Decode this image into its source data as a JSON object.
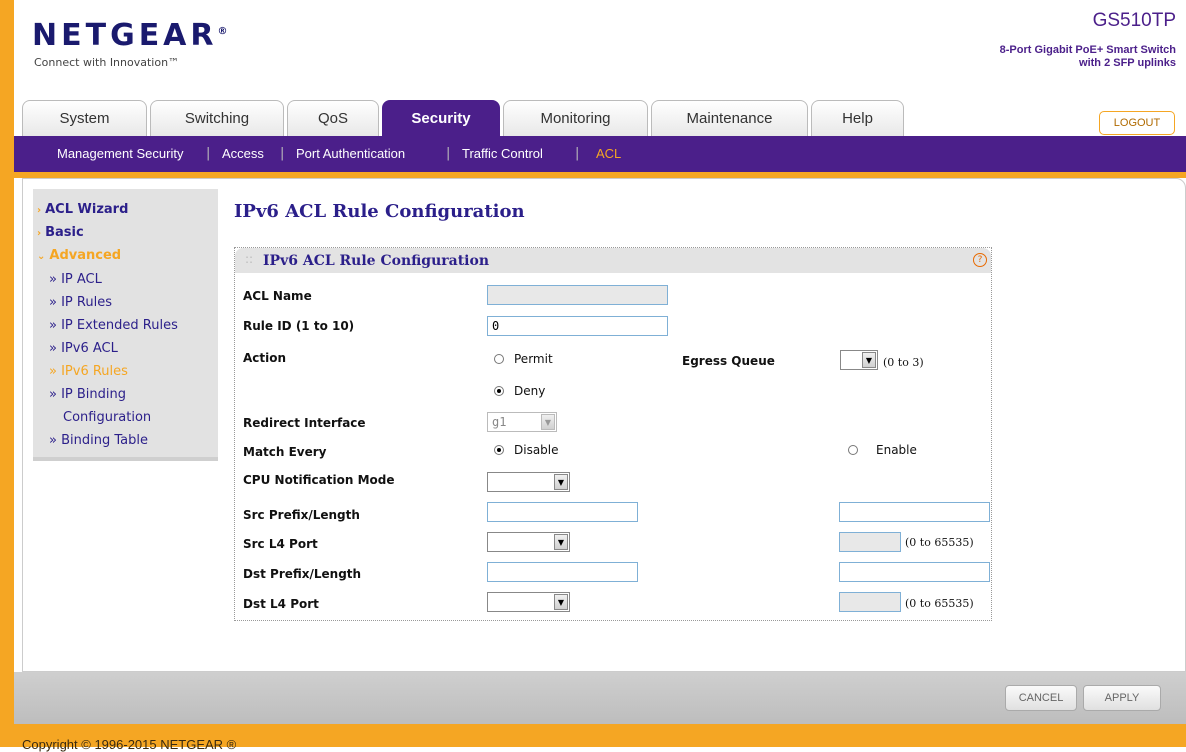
{
  "header": {
    "logo": "NETGEAR",
    "logo_mark": "®",
    "tagline": "Connect with Innovation™",
    "model": "GS510TP",
    "model_desc_line1": "8-Port Gigabit PoE+ Smart Switch",
    "model_desc_line2": "with 2 SFP uplinks",
    "logout": "LOGOUT"
  },
  "tabs": [
    "System",
    "Switching",
    "QoS",
    "Security",
    "Monitoring",
    "Maintenance",
    "Help"
  ],
  "subnav": [
    "Management Security",
    "Access",
    "Port Authentication",
    "Traffic Control",
    "ACL"
  ],
  "sidebar": {
    "acl_wizard": "ACL Wizard",
    "basic": "Basic",
    "advanced": "Advanced",
    "items": [
      "» IP ACL",
      "» IP Rules",
      "» IP Extended Rules",
      "» IPv6 ACL",
      "» IPv6 Rules",
      "» IP Binding",
      "Configuration",
      "» Binding Table"
    ]
  },
  "page": {
    "title": "IPv6 ACL Rule Configuration",
    "panel_title": "IPv6 ACL Rule Configuration"
  },
  "form": {
    "acl_name_label": "ACL Name",
    "acl_name_value": "",
    "rule_id_label": "Rule ID (1 to 10)",
    "rule_id_value": "0",
    "action_label": "Action",
    "permit": "Permit",
    "deny": "Deny",
    "egress_queue_label": "Egress Queue",
    "egress_queue_range": "(0 to 3)",
    "redirect_label": "Redirect Interface",
    "redirect_value": "g1",
    "match_every_label": "Match Every",
    "disable": "Disable",
    "enable": "Enable",
    "cpu_label": "CPU Notification Mode",
    "src_prefix_label": "Src Prefix/Length",
    "src_l4_label": "Src L4 Port",
    "src_l4_range": "(0 to 65535)",
    "dst_prefix_label": "Dst Prefix/Length",
    "dst_l4_label": "Dst L4 Port",
    "dst_l4_range": "(0 to 65535)"
  },
  "buttons": {
    "cancel": "CANCEL",
    "apply": "APPLY"
  },
  "footer": {
    "copyright": "Copyright © 1996-2015 NETGEAR ®"
  }
}
